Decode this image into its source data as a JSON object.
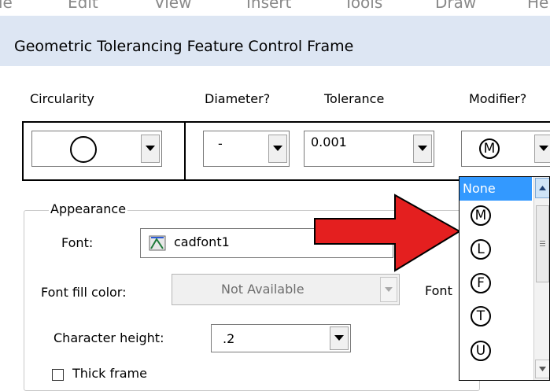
{
  "menu": {
    "items": [
      "le",
      "Edit",
      "View",
      "Insert",
      "Tools",
      "Draw",
      "He"
    ]
  },
  "dialog": {
    "title": "Geometric Tolerancing Feature Control Frame"
  },
  "columns": {
    "symbol_label": "Circularity",
    "diameter_label": "Diameter?",
    "tolerance_label": "Tolerance",
    "modifier_label": "Modifier?"
  },
  "frame": {
    "symbol_icon": "circle-icon",
    "diameter_value": "-",
    "tolerance_value": "0.001",
    "modifier_value": "M"
  },
  "appearance": {
    "group_label": "Appearance",
    "font_label": "Font:",
    "font_value": "cadfont1",
    "font_icon": "cad-font-icon",
    "font_fill_color_label": "Font fill color:",
    "font_fill_color_value": "Not Available",
    "font_right_label": "Font",
    "character_height_label": "Character height:",
    "character_height_value": ".2",
    "thick_frame_label": "Thick frame",
    "thick_frame_checked": false
  },
  "modifier_dropdown": {
    "selected": "None",
    "options": [
      "None",
      "M",
      "L",
      "F",
      "T",
      "U"
    ]
  },
  "annotation": {
    "arrow_color": "#e41f1f",
    "arrow_icon": "red-arrow-icon"
  },
  "colors": {
    "title_bar": "#dde6f3",
    "selection": "#3399ff"
  }
}
